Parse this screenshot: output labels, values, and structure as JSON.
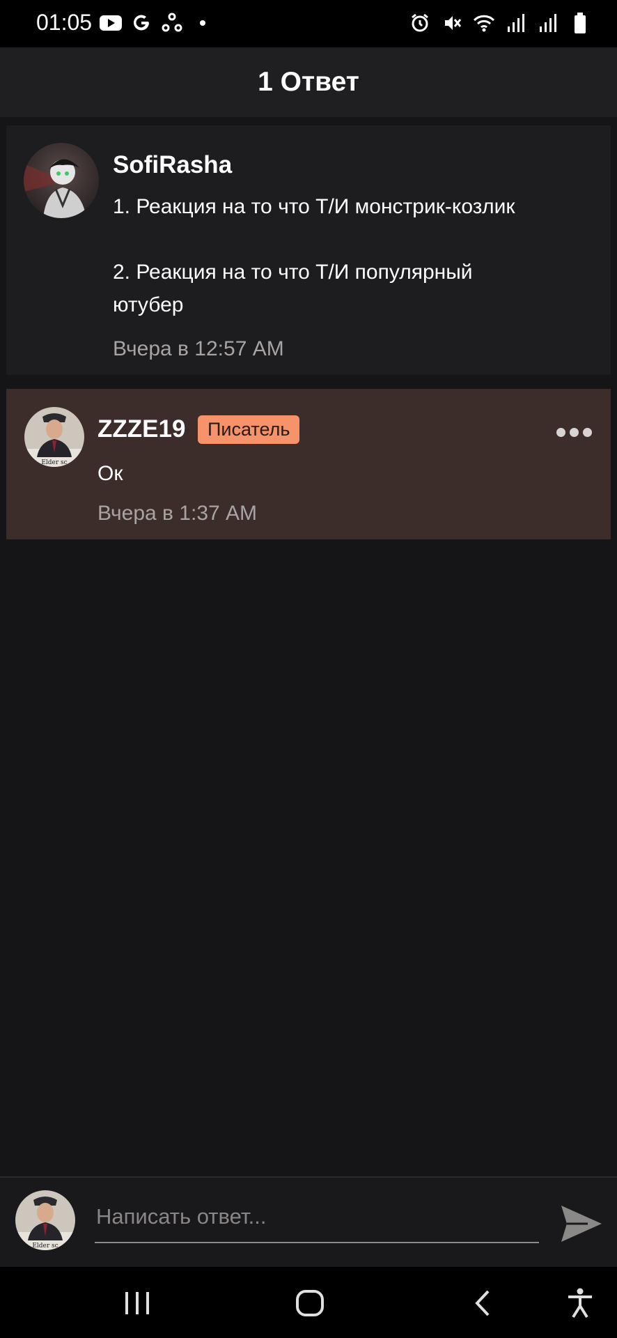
{
  "status_bar": {
    "time": "01:05"
  },
  "header": {
    "title": "1 Ответ"
  },
  "original_comment": {
    "username": "SofiRasha",
    "text": "1. Реакция на то что Т/И монстрик-козлик\n\n2. Реакция на то что Т/И популярный\nютубер",
    "time": "Вчера в 12:57 AM"
  },
  "reply_comment": {
    "username": "ZZZE19",
    "badge": "Писатель",
    "text": "Ок",
    "time": "Вчера в 1:37 AM",
    "avatar_caption": "Elder sc"
  },
  "compose": {
    "placeholder": "Написать ответ..."
  },
  "colors": {
    "reply_highlight": "#3c2d2b",
    "badge": "#f7936a",
    "background": "#151416"
  }
}
